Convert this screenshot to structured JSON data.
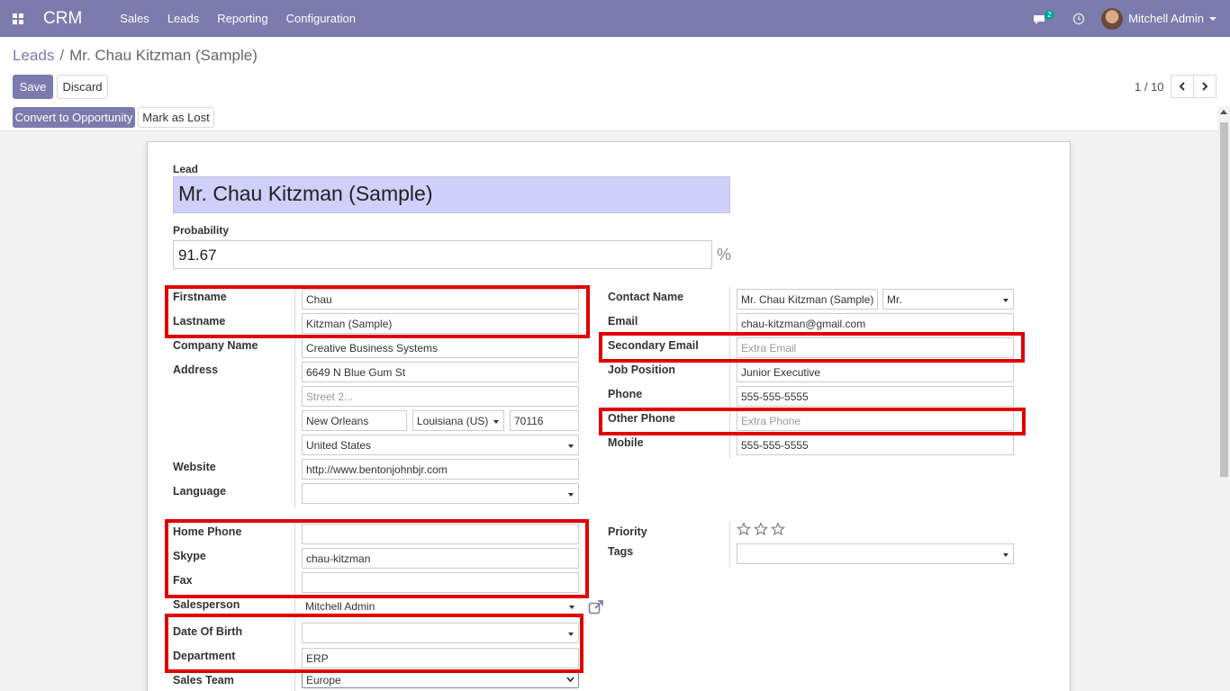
{
  "navbar": {
    "app_name": "CRM",
    "menu": [
      "Sales",
      "Leads",
      "Reporting",
      "Configuration"
    ],
    "chat_badge": "2",
    "user_name": "Mitchell Admin"
  },
  "breadcrumb": {
    "parent": "Leads",
    "separator": "/",
    "current": "Mr. Chau Kitzman (Sample)"
  },
  "buttons": {
    "save": "Save",
    "discard": "Discard",
    "convert": "Convert to Opportunity",
    "mark_lost": "Mark as Lost"
  },
  "pager": {
    "value": "1 / 10"
  },
  "form": {
    "lead_label": "Lead",
    "lead_name": "Mr. Chau Kitzman (Sample)",
    "probability_label": "Probability",
    "probability": "91.67",
    "percent_sign": "%",
    "left": {
      "firstname_label": "Firstname",
      "firstname": "Chau",
      "lastname_label": "Lastname",
      "lastname": "Kitzman (Sample)",
      "company_label": "Company Name",
      "company": "Creative Business Systems",
      "address_label": "Address",
      "street": "6649 N Blue Gum St",
      "street2_placeholder": "Street 2...",
      "city": "New Orleans",
      "state": "Louisiana (US)",
      "zip": "70116",
      "country": "United States",
      "website_label": "Website",
      "website": "http://www.bentonjohnbjr.com",
      "language_label": "Language",
      "language": "",
      "home_phone_label": "Home Phone",
      "home_phone": "",
      "skype_label": "Skype",
      "skype": "chau-kitzman",
      "fax_label": "Fax",
      "fax": "",
      "salesperson_label": "Salesperson",
      "salesperson": "Mitchell Admin",
      "dob_label": "Date Of Birth",
      "dob": "",
      "department_label": "Department",
      "department": "ERP",
      "sales_team_label": "Sales Team",
      "sales_team": "Europe"
    },
    "right": {
      "contact_name_label": "Contact Name",
      "contact_name": "Mr. Chau Kitzman (Sample)",
      "title": "Mr.",
      "email_label": "Email",
      "email": "chau-kitzman@gmail.com",
      "secondary_email_label": "Secondary Email",
      "secondary_email_placeholder": "Extra Email",
      "job_position_label": "Job Position",
      "job_position": "Junior Executive",
      "phone_label": "Phone",
      "phone": "555-555-5555",
      "other_phone_label": "Other Phone",
      "other_phone_placeholder": "Extra Phone",
      "mobile_label": "Mobile",
      "mobile": "555-555-5555",
      "priority_label": "Priority",
      "priority_stars": 0,
      "tags_label": "Tags",
      "tags": ""
    }
  },
  "colors": {
    "brand": "#7c7bad",
    "highlight": "#e00000",
    "title_bg": "#d0d0fa"
  }
}
